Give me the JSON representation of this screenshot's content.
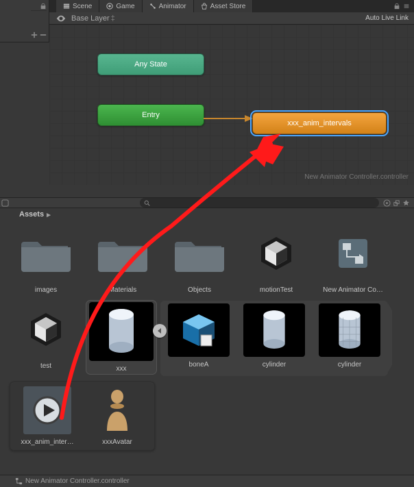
{
  "tabs": {
    "scene": {
      "label": "Scene"
    },
    "game": {
      "label": "Game"
    },
    "animator": {
      "label": "Animator"
    },
    "assetStore": {
      "label": "Asset Store"
    }
  },
  "crumb": {
    "label": "Base Layer",
    "menu_button": "menu"
  },
  "autoLiveLink": "Auto Live Link",
  "animator": {
    "anyState": "Any State",
    "entry": "Entry",
    "stateName": "xxx_anim_intervals",
    "controllerLabel": "New Animator Controller.controller"
  },
  "assetsHeader": "Assets",
  "assets": {
    "row1": [
      {
        "label": "images",
        "type": "folder"
      },
      {
        "label": "Materials",
        "type": "folder"
      },
      {
        "label": "Objects",
        "type": "folder"
      },
      {
        "label": "motionTest",
        "type": "unity-scene"
      },
      {
        "label": "New Animator Co…",
        "type": "anim-controller"
      }
    ],
    "row2_left": {
      "label": "test",
      "type": "unity-scene"
    },
    "xxx": {
      "label": "xxx"
    },
    "grouped": [
      {
        "label": "boneA",
        "type": "cube"
      },
      {
        "label": "cylinder",
        "type": "cylinder"
      },
      {
        "label": "cylinder",
        "type": "cylinder-wire"
      }
    ],
    "row3": [
      {
        "label": "xxx_anim_inter…",
        "type": "clip"
      },
      {
        "label": "xxxAvatar",
        "type": "avatar"
      }
    ]
  },
  "bottomBar": "New Animator Controller.controller"
}
